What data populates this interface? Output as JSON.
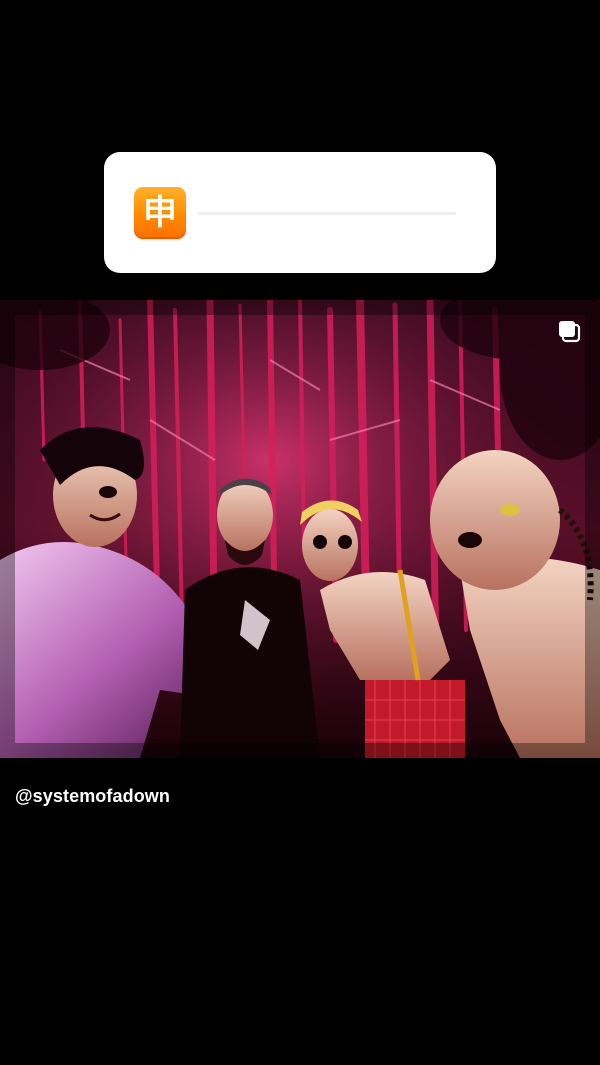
{
  "sticker": {
    "emoji_glyph": "申",
    "emoji_name": "chinese-application-button",
    "emoji_color": "#ff8a00",
    "slider_value": 0.0
  },
  "post": {
    "image_description": "band photo",
    "multiple_images_icon": "copy-icon",
    "username": "@systemofadown"
  },
  "colors": {
    "background": "#000000",
    "sticker_bg": "#ffffff",
    "username_text": "#ffffff"
  }
}
